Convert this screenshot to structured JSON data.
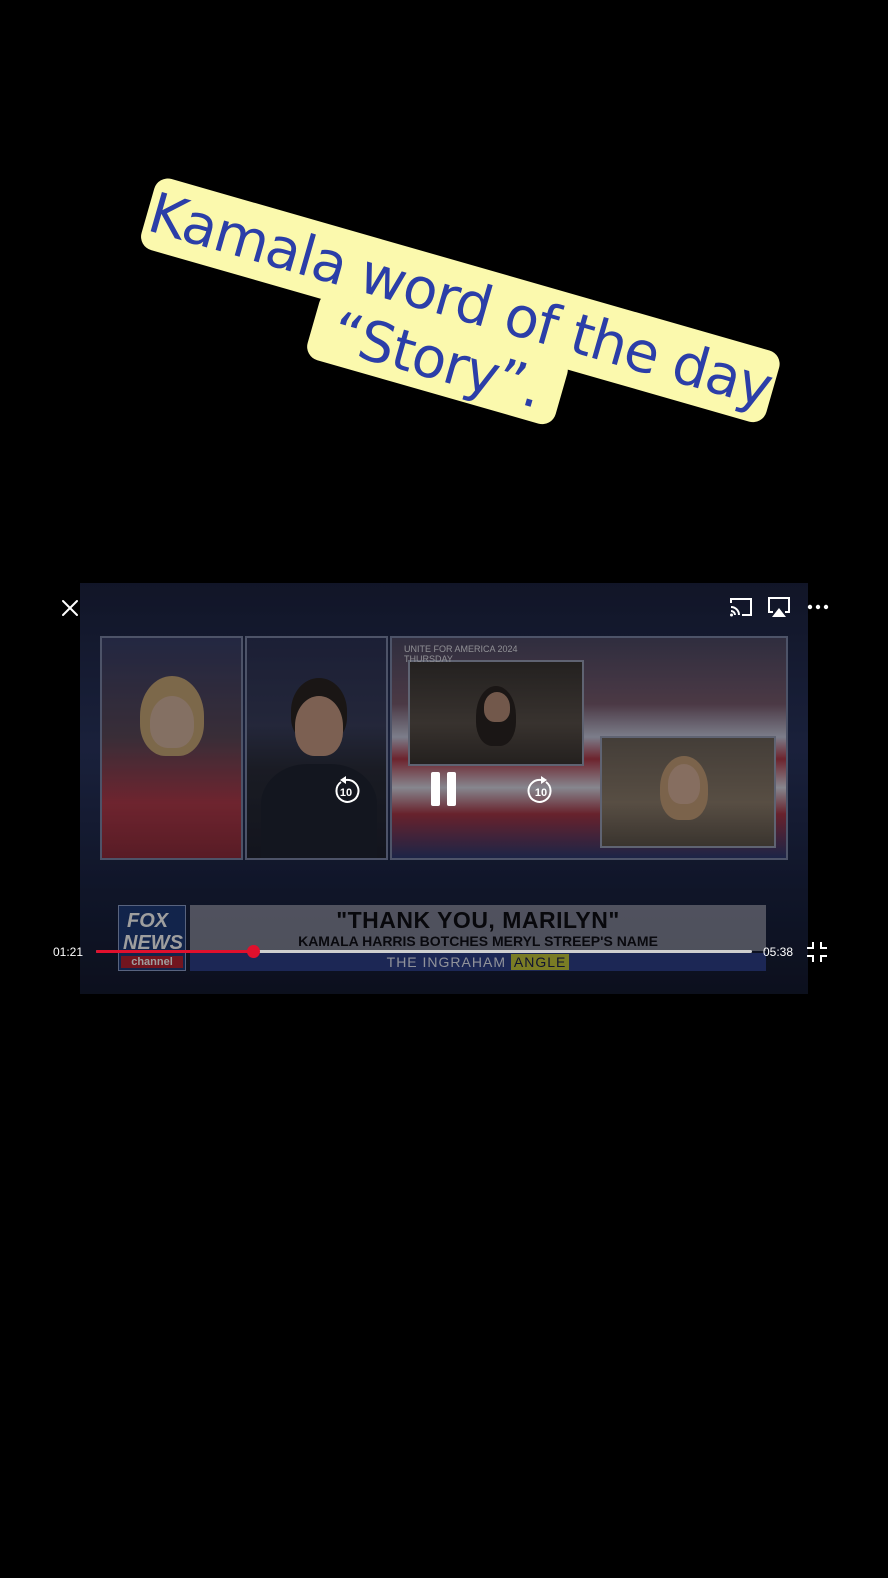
{
  "caption": {
    "line1": "Kamala word of the day",
    "line2": "“Story”."
  },
  "video": {
    "inset_label_1": "UNITE FOR AMERICA 2024",
    "inset_label_2": "THURSDAY",
    "logo_line1": "FOX",
    "logo_line2": "NEWS",
    "logo_line3": "channel",
    "headline": "\"THANK YOU, MARILYN\"",
    "subhead": "KAMALA HARRIS BOTCHES MERYL STREEP'S NAME",
    "show_name_1": "THE INGRAHAM",
    "show_name_2": "ANGLE"
  },
  "player": {
    "current_time": "01:21",
    "duration": "05:38",
    "progress_fraction": 0.24,
    "rewind_seconds": "10",
    "forward_seconds": "10",
    "accent_color": "#e0102d",
    "icons": [
      "close-icon",
      "cast-icon",
      "airplay-icon",
      "more-icon",
      "rewind-10-icon",
      "pause-icon",
      "forward-10-icon",
      "exit-fullscreen-icon"
    ]
  }
}
